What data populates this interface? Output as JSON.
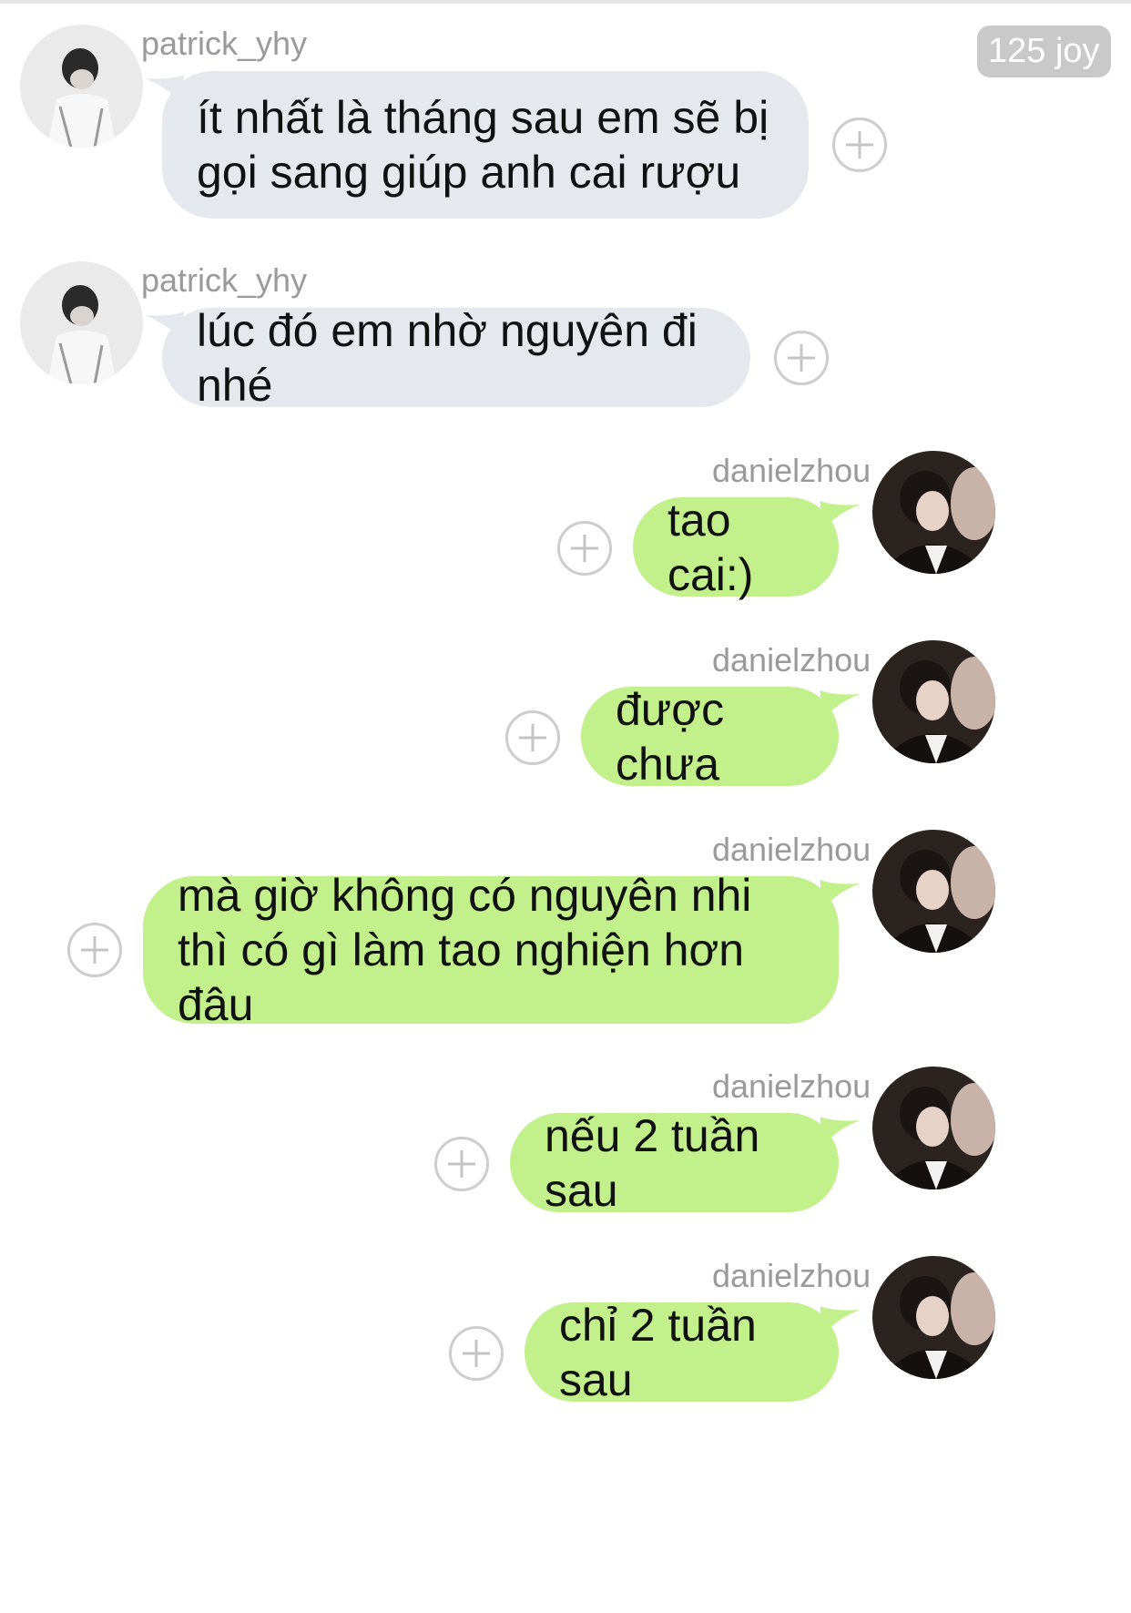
{
  "header": {
    "badge": "125 joy"
  },
  "messages": [
    {
      "user": "patrick_yhy",
      "side": "left",
      "text": "ít nhất là tháng sau em sẽ bị gọi sang giúp anh cai rượu"
    },
    {
      "user": "patrick_yhy",
      "side": "left",
      "text": "lúc đó em nhờ nguyên đi nhé"
    },
    {
      "user": "danielzhou",
      "side": "right",
      "text": "tao cai:)"
    },
    {
      "user": "danielzhou",
      "side": "right",
      "text": "được chưa"
    },
    {
      "user": "danielzhou",
      "side": "right",
      "text": "mà giờ không có nguyên nhi thì có gì làm tao nghiện hơn đâu"
    },
    {
      "user": "danielzhou",
      "side": "right",
      "text": "nếu 2 tuần sau"
    },
    {
      "user": "danielzhou",
      "side": "right",
      "text": "chỉ 2 tuần sau"
    }
  ],
  "colors": {
    "incoming_bubble": "#e5e8ec",
    "outgoing_bubble": "#c2f08a",
    "username": "#9a9a9a",
    "badge_bg": "#c9c9c9"
  },
  "icons": {
    "add": "add-reaction-icon"
  }
}
